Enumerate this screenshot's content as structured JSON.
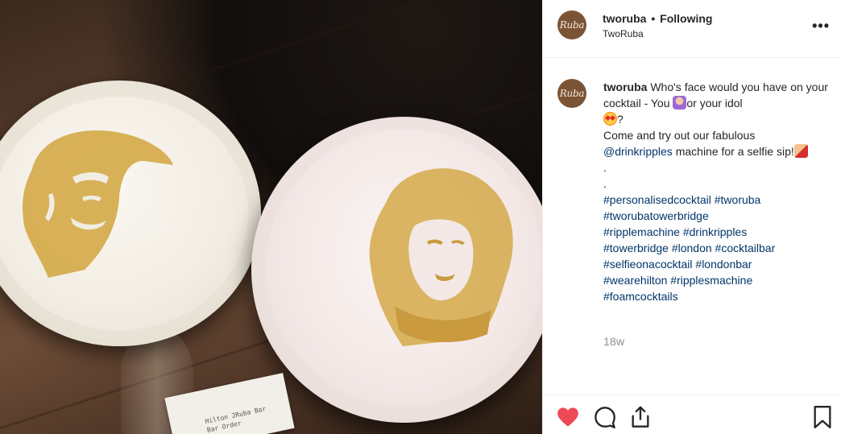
{
  "photo": {
    "receipt_line1": "Hilton 2Ruba Bar",
    "receipt_line2": "Bar Order"
  },
  "header": {
    "avatar_text": "Ruba",
    "username": "tworuba",
    "separator": "•",
    "follow_label": "Following",
    "subtitle": "TwoRuba",
    "more_label": "•••"
  },
  "caption": {
    "avatar_text": "Ruba",
    "username": "tworuba",
    "line1_text": "Who's face would you have on your cocktail - You",
    "line1_emoji": "woman-raising-hand-emoji",
    "line1_after": "or your idol",
    "line2_emoji": "star-struck-emoji",
    "line2_after": "?",
    "line3": "Come and try out our fabulous",
    "mention": "@drinkripples",
    "line4_after": "machine for a selfie sip!",
    "line4_emoji": "selfie-emoji",
    "dot1": ".",
    "dot2": ".",
    "hashtags": [
      "#personalisedcocktail",
      "#tworuba",
      "#tworubatowerbridge",
      "#ripplemachine",
      "#drinkripples",
      "#towerbridge",
      "#london",
      "#cocktailbar",
      "#selfieonacocktail",
      "#londonbar",
      "#wearehilton",
      "#ripplesmachine",
      "#foamcocktails"
    ],
    "time": "18w"
  },
  "actions": {
    "like_icon": "heart-icon",
    "comment_icon": "comment-icon",
    "share_icon": "share-icon",
    "save_icon": "bookmark-icon",
    "like_color": "#ed4956"
  },
  "colors": {
    "link": "#003569",
    "secondary_text": "#8e8e8e",
    "brand_avatar": "#7b5436"
  }
}
